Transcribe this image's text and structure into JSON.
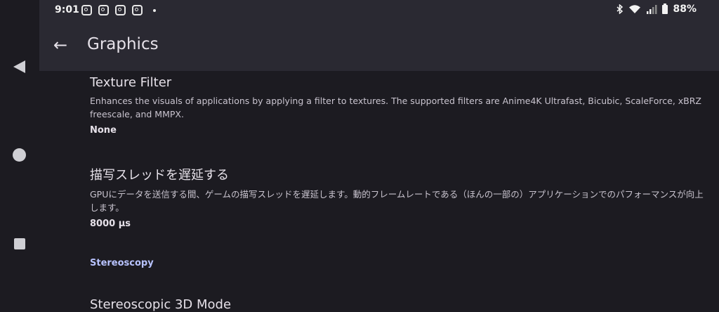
{
  "status_bar": {
    "time": "9:01",
    "battery_percent": "88%",
    "notification_icons": [
      "instagram-icon",
      "instagram-icon",
      "instagram-icon",
      "instagram-icon"
    ]
  },
  "app_bar": {
    "title": "Graphics"
  },
  "settings": [
    {
      "title": "Texture Filter",
      "description": "Enhances the visuals of applications by applying a filter to textures. The supported filters are Anime4K Ultrafast, Bicubic, ScaleForce, xBRZ freescale, and MMPX.",
      "value": "None"
    },
    {
      "title": "描写スレッドを遅延する",
      "description": "GPUにデータを送信する間、ゲームの描写スレッドを遅延します。動的フレームレートである（ほんの一部の）アプリケーションでのパフォーマンスが向上します。",
      "value": "8000 µs"
    }
  ],
  "section": {
    "label": "Stereoscopy"
  },
  "next_setting": {
    "title": "Stereoscopic 3D Mode"
  },
  "colors": {
    "background": "#1c1b21",
    "app_bar": "#2a2932",
    "accent": "#b8c3ff"
  }
}
